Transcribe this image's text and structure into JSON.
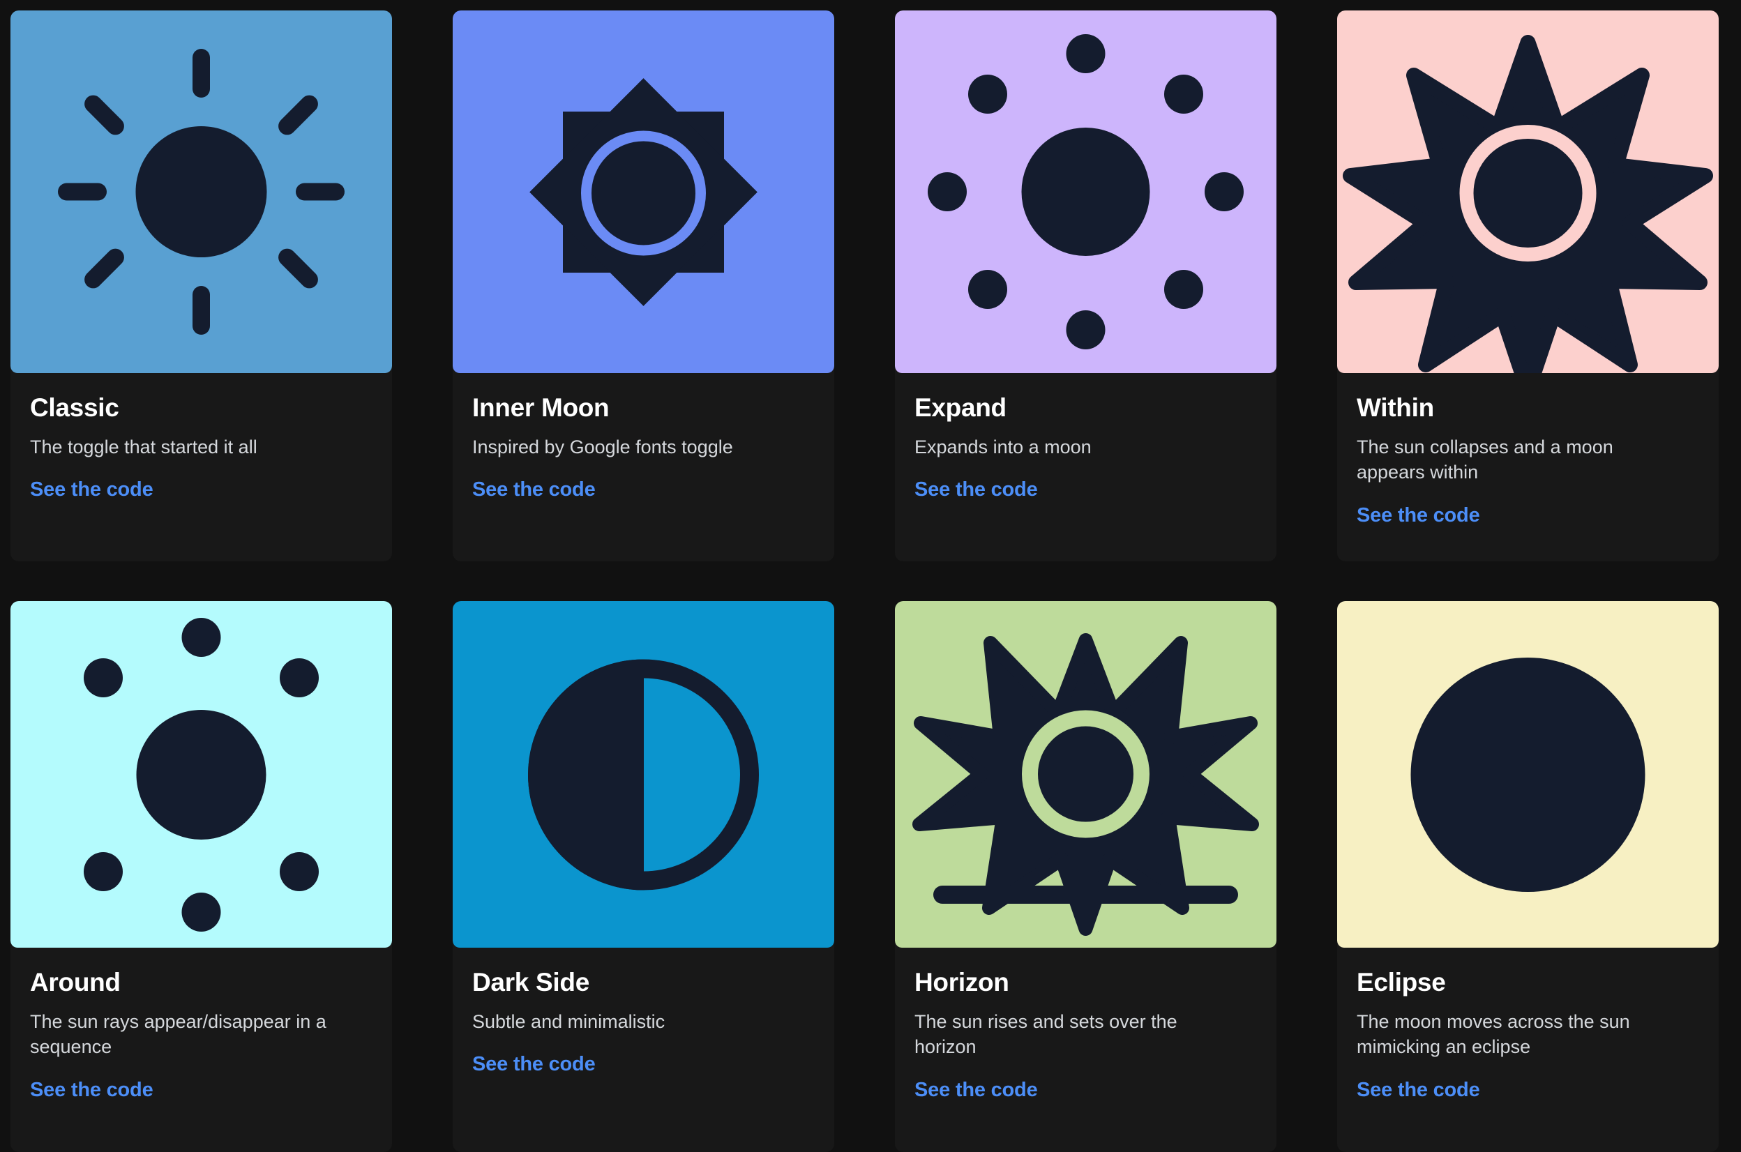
{
  "page": {
    "background": "#111111",
    "card_background": "#181818",
    "link_color": "#4c8ef7",
    "icon_color": "#141c2e",
    "link_label": "See the code"
  },
  "cards": [
    {
      "id": "classic",
      "title": "Classic",
      "description": "The toggle that started it all",
      "link": "See the code",
      "tile_color": "#59a0d2",
      "icon": "sun-rays-icon"
    },
    {
      "id": "inner-moon",
      "title": "Inner Moon",
      "description": "Inspired by Google fonts toggle",
      "link": "See the code",
      "tile_color": "#6b8bf5",
      "icon": "eight-point-star-ring-icon"
    },
    {
      "id": "expand",
      "title": "Expand",
      "description": "Expands into a moon",
      "link": "See the code",
      "tile_color": "#cdb5fc",
      "icon": "sun-dots-icon"
    },
    {
      "id": "within",
      "title": "Within",
      "description": "The sun collapses and a moon appears within",
      "link": "See the code",
      "tile_color": "#fcd0cd",
      "icon": "spiky-star-ring-icon"
    },
    {
      "id": "around",
      "title": "Around",
      "description": "The sun rays appear/disappear in a sequence",
      "link": "See the code",
      "tile_color": "#b4fbfd",
      "icon": "sun-dots-icon"
    },
    {
      "id": "dark-side",
      "title": "Dark Side",
      "description": "Subtle and minimalistic",
      "link": "See the code",
      "tile_color": "#0b95ce",
      "icon": "half-moon-ring-icon"
    },
    {
      "id": "horizon",
      "title": "Horizon",
      "description": "The sun rises and sets over the horizon",
      "link": "See the code",
      "tile_color": "#bedb9b",
      "icon": "spiky-star-ring-horizon-icon"
    },
    {
      "id": "eclipse",
      "title": "Eclipse",
      "description": "The moon moves across the sun mimicking an eclipse",
      "link": "See the code",
      "tile_color": "#f7f0c3",
      "icon": "filled-circle-icon"
    }
  ]
}
